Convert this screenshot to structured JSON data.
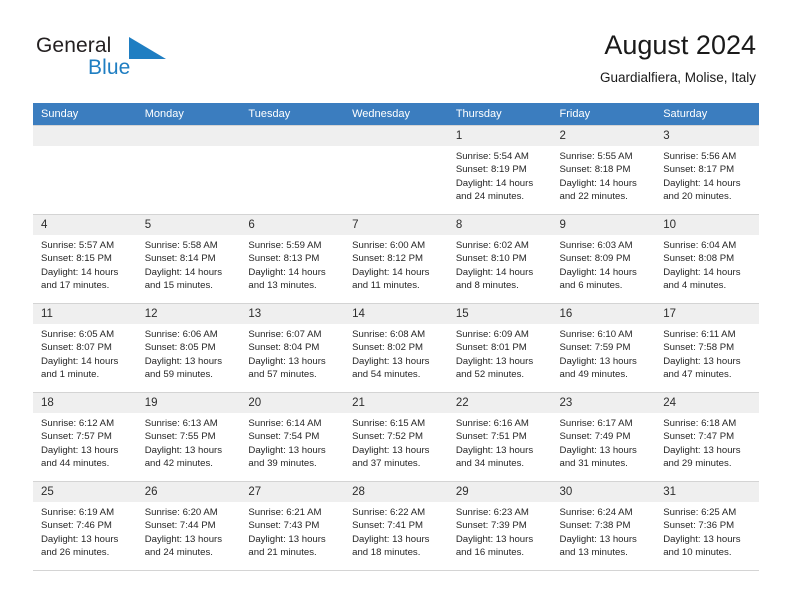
{
  "brand": {
    "name_part1": "General",
    "name_part2": "Blue",
    "logo_icon": "triangle-logo-icon"
  },
  "header": {
    "title": "August 2024",
    "location": "Guardialfiera, Molise, Italy"
  },
  "colors": {
    "header_row_bg": "#3b7dbf",
    "brand_blue": "#1f7ec2",
    "daynum_bg": "#efefef",
    "grid_line": "#d4d4d4"
  },
  "weekdays": [
    "Sunday",
    "Monday",
    "Tuesday",
    "Wednesday",
    "Thursday",
    "Friday",
    "Saturday"
  ],
  "weeks": [
    [
      {
        "day": "",
        "empty": true
      },
      {
        "day": "",
        "empty": true
      },
      {
        "day": "",
        "empty": true
      },
      {
        "day": "",
        "empty": true
      },
      {
        "day": "1",
        "sunrise": "Sunrise: 5:54 AM",
        "sunset": "Sunset: 8:19 PM",
        "daylight1": "Daylight: 14 hours",
        "daylight2": "and 24 minutes."
      },
      {
        "day": "2",
        "sunrise": "Sunrise: 5:55 AM",
        "sunset": "Sunset: 8:18 PM",
        "daylight1": "Daylight: 14 hours",
        "daylight2": "and 22 minutes."
      },
      {
        "day": "3",
        "sunrise": "Sunrise: 5:56 AM",
        "sunset": "Sunset: 8:17 PM",
        "daylight1": "Daylight: 14 hours",
        "daylight2": "and 20 minutes."
      }
    ],
    [
      {
        "day": "4",
        "sunrise": "Sunrise: 5:57 AM",
        "sunset": "Sunset: 8:15 PM",
        "daylight1": "Daylight: 14 hours",
        "daylight2": "and 17 minutes."
      },
      {
        "day": "5",
        "sunrise": "Sunrise: 5:58 AM",
        "sunset": "Sunset: 8:14 PM",
        "daylight1": "Daylight: 14 hours",
        "daylight2": "and 15 minutes."
      },
      {
        "day": "6",
        "sunrise": "Sunrise: 5:59 AM",
        "sunset": "Sunset: 8:13 PM",
        "daylight1": "Daylight: 14 hours",
        "daylight2": "and 13 minutes."
      },
      {
        "day": "7",
        "sunrise": "Sunrise: 6:00 AM",
        "sunset": "Sunset: 8:12 PM",
        "daylight1": "Daylight: 14 hours",
        "daylight2": "and 11 minutes."
      },
      {
        "day": "8",
        "sunrise": "Sunrise: 6:02 AM",
        "sunset": "Sunset: 8:10 PM",
        "daylight1": "Daylight: 14 hours",
        "daylight2": "and 8 minutes."
      },
      {
        "day": "9",
        "sunrise": "Sunrise: 6:03 AM",
        "sunset": "Sunset: 8:09 PM",
        "daylight1": "Daylight: 14 hours",
        "daylight2": "and 6 minutes."
      },
      {
        "day": "10",
        "sunrise": "Sunrise: 6:04 AM",
        "sunset": "Sunset: 8:08 PM",
        "daylight1": "Daylight: 14 hours",
        "daylight2": "and 4 minutes."
      }
    ],
    [
      {
        "day": "11",
        "sunrise": "Sunrise: 6:05 AM",
        "sunset": "Sunset: 8:07 PM",
        "daylight1": "Daylight: 14 hours",
        "daylight2": "and 1 minute."
      },
      {
        "day": "12",
        "sunrise": "Sunrise: 6:06 AM",
        "sunset": "Sunset: 8:05 PM",
        "daylight1": "Daylight: 13 hours",
        "daylight2": "and 59 minutes."
      },
      {
        "day": "13",
        "sunrise": "Sunrise: 6:07 AM",
        "sunset": "Sunset: 8:04 PM",
        "daylight1": "Daylight: 13 hours",
        "daylight2": "and 57 minutes."
      },
      {
        "day": "14",
        "sunrise": "Sunrise: 6:08 AM",
        "sunset": "Sunset: 8:02 PM",
        "daylight1": "Daylight: 13 hours",
        "daylight2": "and 54 minutes."
      },
      {
        "day": "15",
        "sunrise": "Sunrise: 6:09 AM",
        "sunset": "Sunset: 8:01 PM",
        "daylight1": "Daylight: 13 hours",
        "daylight2": "and 52 minutes."
      },
      {
        "day": "16",
        "sunrise": "Sunrise: 6:10 AM",
        "sunset": "Sunset: 7:59 PM",
        "daylight1": "Daylight: 13 hours",
        "daylight2": "and 49 minutes."
      },
      {
        "day": "17",
        "sunrise": "Sunrise: 6:11 AM",
        "sunset": "Sunset: 7:58 PM",
        "daylight1": "Daylight: 13 hours",
        "daylight2": "and 47 minutes."
      }
    ],
    [
      {
        "day": "18",
        "sunrise": "Sunrise: 6:12 AM",
        "sunset": "Sunset: 7:57 PM",
        "daylight1": "Daylight: 13 hours",
        "daylight2": "and 44 minutes."
      },
      {
        "day": "19",
        "sunrise": "Sunrise: 6:13 AM",
        "sunset": "Sunset: 7:55 PM",
        "daylight1": "Daylight: 13 hours",
        "daylight2": "and 42 minutes."
      },
      {
        "day": "20",
        "sunrise": "Sunrise: 6:14 AM",
        "sunset": "Sunset: 7:54 PM",
        "daylight1": "Daylight: 13 hours",
        "daylight2": "and 39 minutes."
      },
      {
        "day": "21",
        "sunrise": "Sunrise: 6:15 AM",
        "sunset": "Sunset: 7:52 PM",
        "daylight1": "Daylight: 13 hours",
        "daylight2": "and 37 minutes."
      },
      {
        "day": "22",
        "sunrise": "Sunrise: 6:16 AM",
        "sunset": "Sunset: 7:51 PM",
        "daylight1": "Daylight: 13 hours",
        "daylight2": "and 34 minutes."
      },
      {
        "day": "23",
        "sunrise": "Sunrise: 6:17 AM",
        "sunset": "Sunset: 7:49 PM",
        "daylight1": "Daylight: 13 hours",
        "daylight2": "and 31 minutes."
      },
      {
        "day": "24",
        "sunrise": "Sunrise: 6:18 AM",
        "sunset": "Sunset: 7:47 PM",
        "daylight1": "Daylight: 13 hours",
        "daylight2": "and 29 minutes."
      }
    ],
    [
      {
        "day": "25",
        "sunrise": "Sunrise: 6:19 AM",
        "sunset": "Sunset: 7:46 PM",
        "daylight1": "Daylight: 13 hours",
        "daylight2": "and 26 minutes."
      },
      {
        "day": "26",
        "sunrise": "Sunrise: 6:20 AM",
        "sunset": "Sunset: 7:44 PM",
        "daylight1": "Daylight: 13 hours",
        "daylight2": "and 24 minutes."
      },
      {
        "day": "27",
        "sunrise": "Sunrise: 6:21 AM",
        "sunset": "Sunset: 7:43 PM",
        "daylight1": "Daylight: 13 hours",
        "daylight2": "and 21 minutes."
      },
      {
        "day": "28",
        "sunrise": "Sunrise: 6:22 AM",
        "sunset": "Sunset: 7:41 PM",
        "daylight1": "Daylight: 13 hours",
        "daylight2": "and 18 minutes."
      },
      {
        "day": "29",
        "sunrise": "Sunrise: 6:23 AM",
        "sunset": "Sunset: 7:39 PM",
        "daylight1": "Daylight: 13 hours",
        "daylight2": "and 16 minutes."
      },
      {
        "day": "30",
        "sunrise": "Sunrise: 6:24 AM",
        "sunset": "Sunset: 7:38 PM",
        "daylight1": "Daylight: 13 hours",
        "daylight2": "and 13 minutes."
      },
      {
        "day": "31",
        "sunrise": "Sunrise: 6:25 AM",
        "sunset": "Sunset: 7:36 PM",
        "daylight1": "Daylight: 13 hours",
        "daylight2": "and 10 minutes."
      }
    ]
  ]
}
